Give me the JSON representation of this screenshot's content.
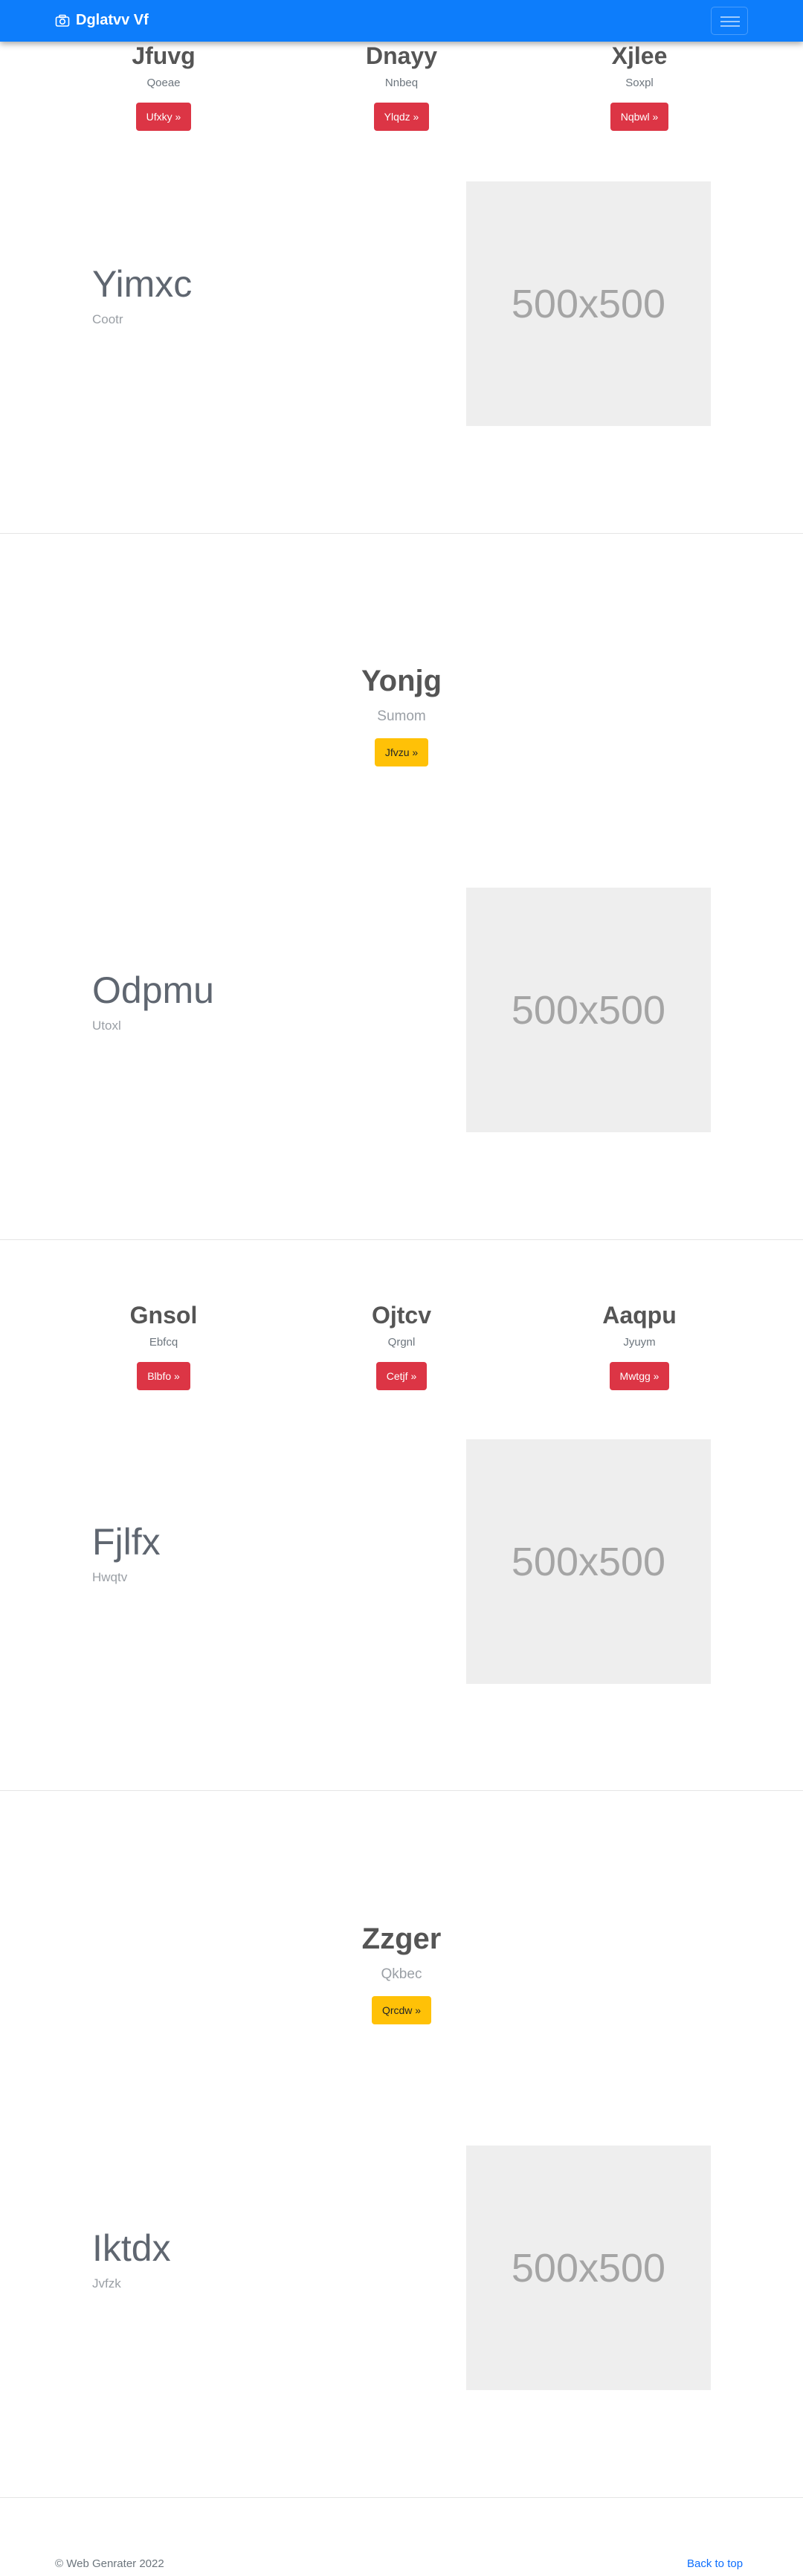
{
  "navbar": {
    "brand": "Dglatvv Vf",
    "icon": "camera-icon",
    "menu_icon": "hamburger-icon",
    "color": "#0d7dfb"
  },
  "row1": [
    {
      "title": "Jfuvg",
      "text": "Qoeae",
      "button": "Ufxky »"
    },
    {
      "title": "Dnayy",
      "text": "Nnbeq",
      "button": "Ylqdz »"
    },
    {
      "title": "Xjlee",
      "text": "Soxpl",
      "button": "Nqbwl »"
    }
  ],
  "feature1": {
    "title": "Yimxc",
    "subtitle": "Cootr",
    "image": "500x500"
  },
  "hero1": {
    "title": "Yonjg",
    "text": "Sumom",
    "button": "Jfvzu »"
  },
  "feature2": {
    "title": "Odpmu",
    "subtitle": "Utoxl",
    "image": "500x500"
  },
  "row2": [
    {
      "title": "Gnsol",
      "text": "Ebfcq",
      "button": "Blbfo »"
    },
    {
      "title": "Ojtcv",
      "text": "Qrgnl",
      "button": "Cetjf »"
    },
    {
      "title": "Aaqpu",
      "text": "Jyuym",
      "button": "Mwtgg »"
    }
  ],
  "feature3": {
    "title": "Fjlfx",
    "subtitle": "Hwqtv",
    "image": "500x500"
  },
  "hero2": {
    "title": "Zzger",
    "text": "Qkbec",
    "button": "Qrcdw »"
  },
  "feature4": {
    "title": "Iktdx",
    "subtitle": "Jvfzk",
    "image": "500x500"
  },
  "footer": {
    "copyright": "© Web Genrater 2022",
    "back_to_top": "Back to top"
  },
  "colors": {
    "danger": "#dc3545",
    "warning": "#ffc107",
    "link": "#0d6efd"
  }
}
